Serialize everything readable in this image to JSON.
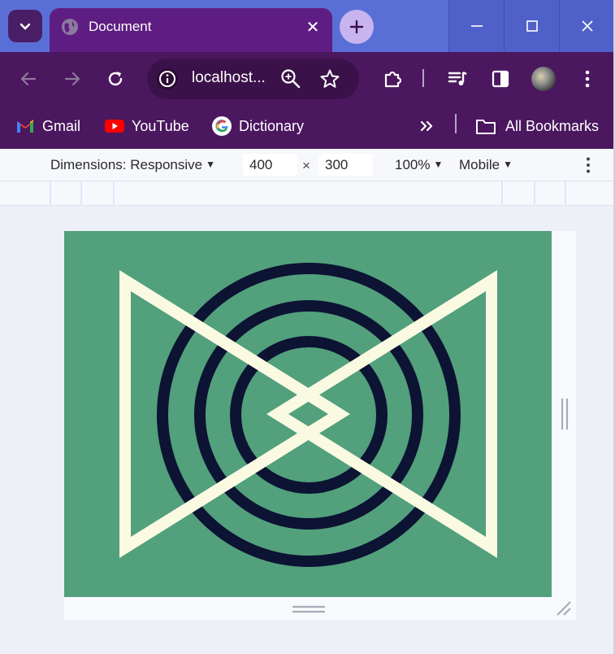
{
  "window": {
    "tab_title": "Document",
    "colors": {
      "accent": "#5e1d82",
      "toolbar": "#4b175f",
      "titlebar": "#6b86e0"
    }
  },
  "toolbar": {
    "url": "localhost..."
  },
  "bookmarks": {
    "items": [
      {
        "label": "Gmail",
        "icon": "gmail-icon"
      },
      {
        "label": "YouTube",
        "icon": "youtube-icon"
      },
      {
        "label": "Dictionary",
        "icon": "google-icon"
      }
    ],
    "all_label": "All Bookmarks"
  },
  "device_toolbar": {
    "dimensions_label": "Dimensions: Responsive",
    "width": "400",
    "times": "×",
    "height": "300",
    "zoom": "100%",
    "mode": "Mobile"
  },
  "page_art": {
    "background": "#52a07c",
    "rings_color": "#0c1333",
    "triangles_color": "#fafae2",
    "rings": 3
  }
}
